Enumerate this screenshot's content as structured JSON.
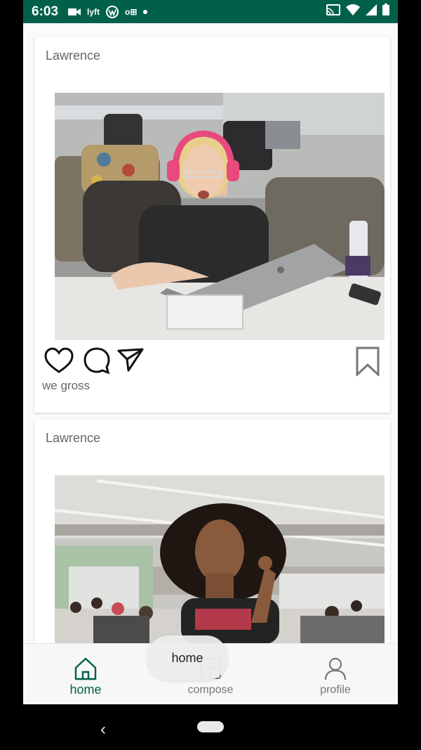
{
  "status_bar": {
    "time": "6:03",
    "notification_icons": [
      "video-icon",
      "lyft-icon",
      "wattpad-icon",
      "outlook-icon",
      "dot-icon"
    ],
    "system_icons": [
      "cast-icon",
      "wifi-icon",
      "signal-icon",
      "battery-icon"
    ],
    "lyft_text": "lyft",
    "outlook_text": "o⊞",
    "background": "#00604a"
  },
  "posts": [
    {
      "author": "Lawrence",
      "caption": "we gross",
      "image_subject": "woman with pink headphones at laptop"
    },
    {
      "author": "Lawrence",
      "caption": "",
      "image_subject": "woman in open office"
    }
  ],
  "tabs": [
    {
      "label": "home",
      "icon": "home-icon",
      "active": true
    },
    {
      "label": "compose",
      "icon": "plus-square-icon",
      "active": false
    },
    {
      "label": "profile",
      "icon": "person-icon",
      "active": false
    }
  ],
  "tooltip": {
    "text": "home"
  },
  "colors": {
    "accent": "#00604a",
    "inactive": "#777777",
    "author": "#666666"
  }
}
